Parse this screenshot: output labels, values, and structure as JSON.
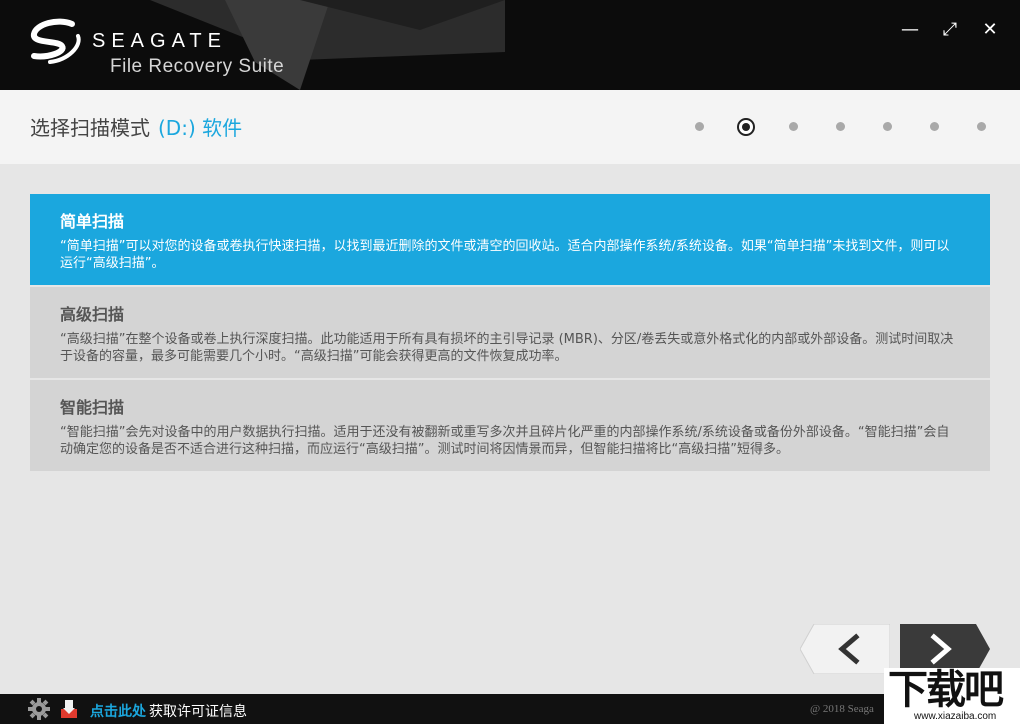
{
  "header": {
    "brand": "SEAGATE",
    "product": "File Recovery Suite",
    "window_controls": {
      "minimize": "—",
      "maximize": "⤢",
      "close": "✕"
    }
  },
  "step": {
    "title": "选择扫描模式",
    "drive": "(D:) 软件",
    "total_steps": 7,
    "active_step": 2
  },
  "options": [
    {
      "title": "简单扫描",
      "desc": "“简单扫描”可以对您的设备或卷执行快速扫描，以找到最近删除的文件或清空的回收站。适合内部操作系统/系统设备。如果“简单扫描”未找到文件，则可以运行“高级扫描”。",
      "selected": true
    },
    {
      "title": "高级扫描",
      "desc": "“高级扫描”在整个设备或卷上执行深度扫描。此功能适用于所有具有损坏的主引导记录 (MBR)、分区/卷丢失或意外格式化的内部或外部设备。测试时间取决于设备的容量，最多可能需要几个小时。“高级扫描”可能会获得更高的文件恢复成功率。",
      "selected": false
    },
    {
      "title": "智能扫描",
      "desc": "“智能扫描”会先对设备中的用户数据执行扫描。适用于还没有被翻新或重写多次并且碎片化严重的内部操作系统/系统设备或备份外部设备。“智能扫描”会自动确定您的设备是否不适合进行这种扫描，而应运行“高级扫描”。测试时间将因情景而异，但智能扫描将比“高级扫描”短得多。",
      "selected": false
    }
  ],
  "footer": {
    "license_link": "点击此处",
    "license_text": "获取许可证信息",
    "copyright": "@ 2018 Seaga"
  },
  "watermark": {
    "big": "下载吧",
    "url": "www.xiazaiba.com"
  },
  "colors": {
    "accent": "#1ba7de",
    "header_bg": "#0c0c0c",
    "option_bg": "#d4d4d4",
    "page_bg": "#e6e6e6"
  }
}
